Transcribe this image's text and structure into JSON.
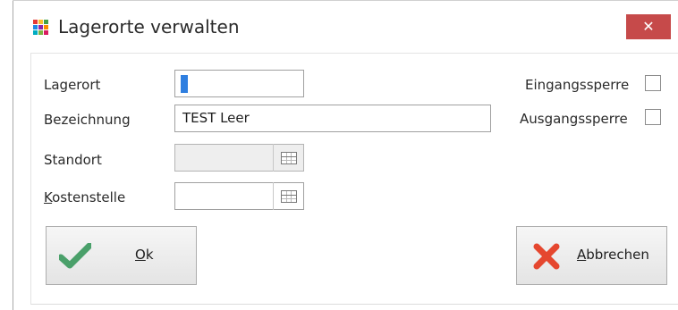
{
  "window": {
    "title": "Lagerorte verwalten",
    "close_label": "✕"
  },
  "form": {
    "lagerort_label": "Lagerort",
    "lagerort_value": "",
    "bezeichnung_label": "Bezeichnung",
    "bezeichnung_value": "TEST Leer",
    "standort_label": "Standort",
    "standort_value": "",
    "kostenstelle_label_first": "K",
    "kostenstelle_label_rest": "ostenstelle",
    "kostenstelle_value": "",
    "eingangssperre_label": "Eingangssperre",
    "ausgangssperre_label": "Ausgangssperre"
  },
  "buttons": {
    "ok_first": "O",
    "ok_rest": "k",
    "cancel_first": "A",
    "cancel_rest": "bbrechen"
  },
  "colors": {
    "close_bg": "#c64a4a",
    "check_green": "#4aa06a",
    "cancel_red": "#e5472f",
    "cursor_blue": "#2f7fe0"
  }
}
